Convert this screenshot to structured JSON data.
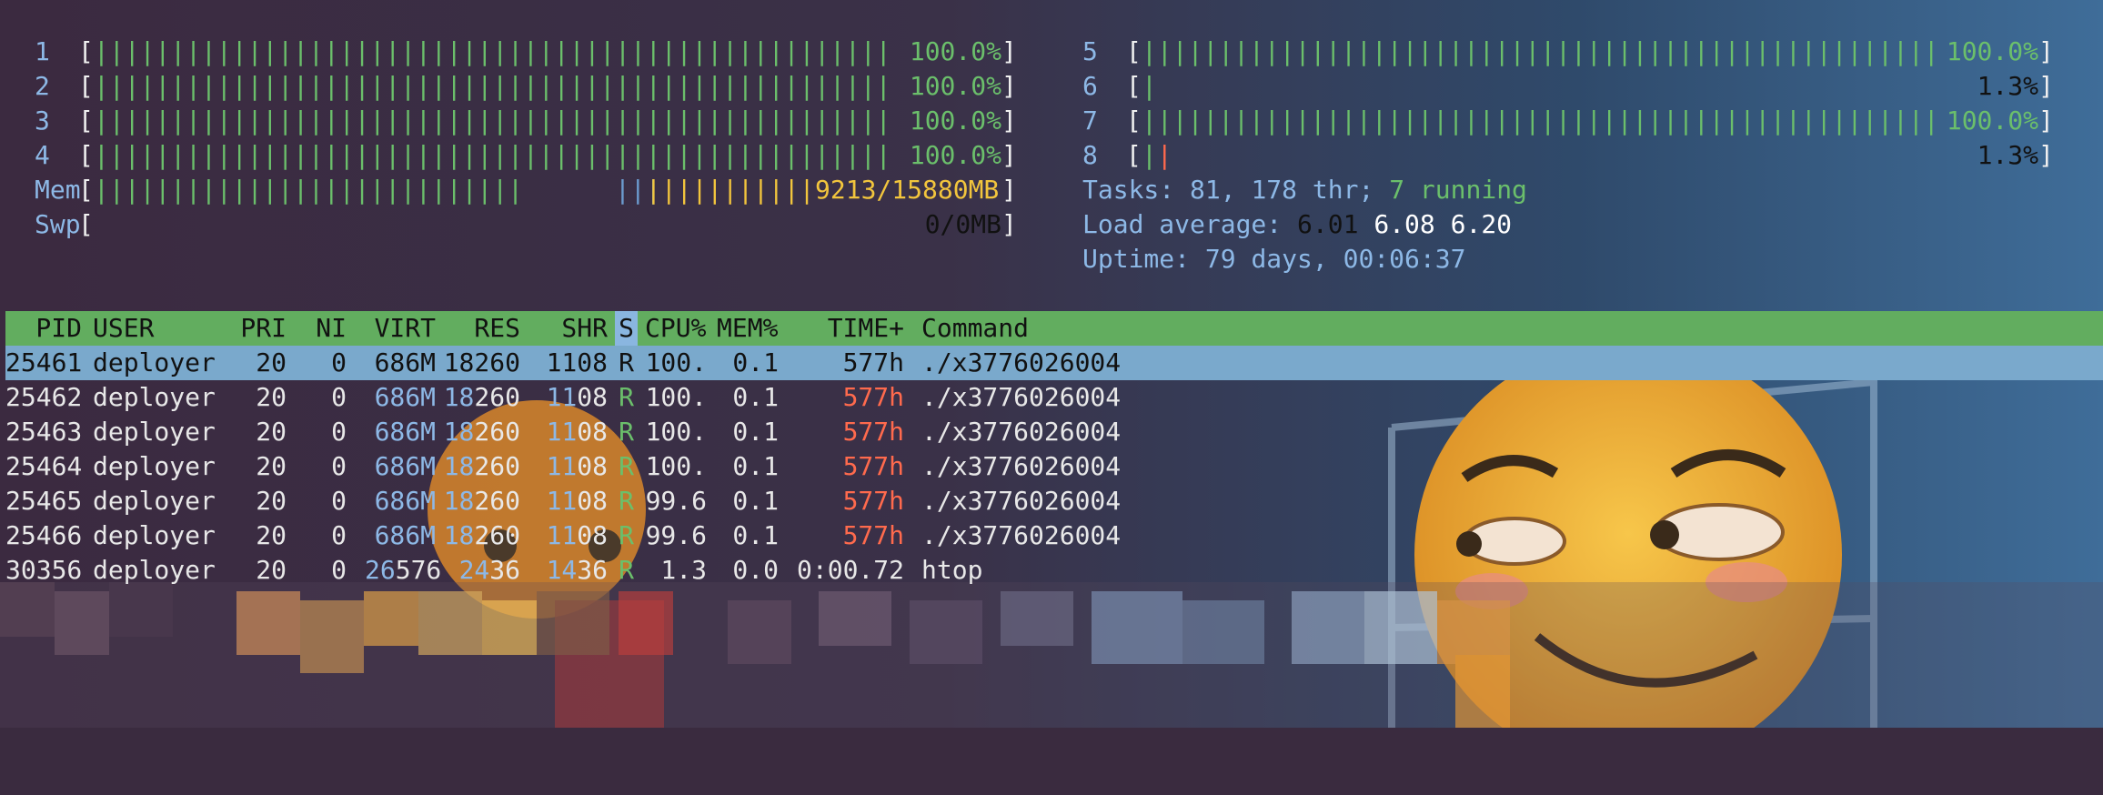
{
  "colors": {
    "bar_green": "#6bbf6b",
    "bar_blue": "#6c9cd0",
    "bar_yellow": "#f2c53d",
    "bar_red": "#ff6a4d",
    "header_bg": "#62ad5f",
    "selected_bg": "#7aa9cc",
    "label_blue": "#8db8e6"
  },
  "cpus": [
    {
      "id": "1",
      "pct": "100.0%",
      "fill": 1.0
    },
    {
      "id": "2",
      "pct": "100.0%",
      "fill": 1.0
    },
    {
      "id": "3",
      "pct": "100.0%",
      "fill": 1.0
    },
    {
      "id": "4",
      "pct": "100.0%",
      "fill": 1.0
    },
    {
      "id": "5",
      "pct": "100.0%",
      "fill": 1.0
    },
    {
      "id": "6",
      "pct": "1.3%",
      "fill": 0.013
    },
    {
      "id": "7",
      "pct": "100.0%",
      "fill": 1.0
    },
    {
      "id": "8",
      "pct": "1.3%",
      "fill": 0.013
    }
  ],
  "mem": {
    "label": "Mem",
    "value": "9213/15880MB"
  },
  "swp": {
    "label": "Swp",
    "value": "0/0MB"
  },
  "tasks": {
    "label": "Tasks:",
    "count": "81,",
    "threads": "178",
    "thr_label": "thr;",
    "running": "7",
    "running_label": "running"
  },
  "load": {
    "label": "Load average:",
    "v1": "6.01",
    "v5": "6.08",
    "v15": "6.20"
  },
  "uptime": {
    "label": "Uptime:",
    "value": "79 days, 00:06:37"
  },
  "header": {
    "pid": "PID",
    "user": "USER",
    "pri": "PRI",
    "ni": "NI",
    "virt": "VIRT",
    "res": "RES",
    "shr": "SHR",
    "s": "S",
    "cpu": "CPU%",
    "mem": "MEM%",
    "time": "TIME+",
    "command": "Command"
  },
  "processes": [
    {
      "pid": "25461",
      "user": "deployer",
      "pri": "20",
      "ni": "0",
      "virt": "686M",
      "res": "18260",
      "shr": "1108",
      "s": "R",
      "cpu": "100.",
      "mem": "0.1",
      "time": "577h",
      "command": "./x3776026004",
      "selected": true
    },
    {
      "pid": "25462",
      "user": "deployer",
      "pri": "20",
      "ni": "0",
      "virt": "686M",
      "res": "18260",
      "shr": "1108",
      "s": "R",
      "cpu": "100.",
      "mem": "0.1",
      "time": "577h",
      "command": "./x3776026004",
      "selected": false
    },
    {
      "pid": "25463",
      "user": "deployer",
      "pri": "20",
      "ni": "0",
      "virt": "686M",
      "res": "18260",
      "shr": "1108",
      "s": "R",
      "cpu": "100.",
      "mem": "0.1",
      "time": "577h",
      "command": "./x3776026004",
      "selected": false
    },
    {
      "pid": "25464",
      "user": "deployer",
      "pri": "20",
      "ni": "0",
      "virt": "686M",
      "res": "18260",
      "shr": "1108",
      "s": "R",
      "cpu": "100.",
      "mem": "0.1",
      "time": "577h",
      "command": "./x3776026004",
      "selected": false
    },
    {
      "pid": "25465",
      "user": "deployer",
      "pri": "20",
      "ni": "0",
      "virt": "686M",
      "res": "18260",
      "shr": "1108",
      "s": "R",
      "cpu": "99.6",
      "mem": "0.1",
      "time": "577h",
      "command": "./x3776026004",
      "selected": false
    },
    {
      "pid": "25466",
      "user": "deployer",
      "pri": "20",
      "ni": "0",
      "virt": "686M",
      "res": "18260",
      "shr": "1108",
      "s": "R",
      "cpu": "99.6",
      "mem": "0.1",
      "time": "577h",
      "command": "./x3776026004",
      "selected": false
    },
    {
      "pid": "30356",
      "user": "deployer",
      "pri": "20",
      "ni": "0",
      "virt": "26576",
      "res": "2436",
      "shr": "1436",
      "s": "R",
      "cpu": "1.3",
      "mem": "0.0",
      "time": "0:00.72",
      "command": "htop",
      "selected": false
    }
  ]
}
